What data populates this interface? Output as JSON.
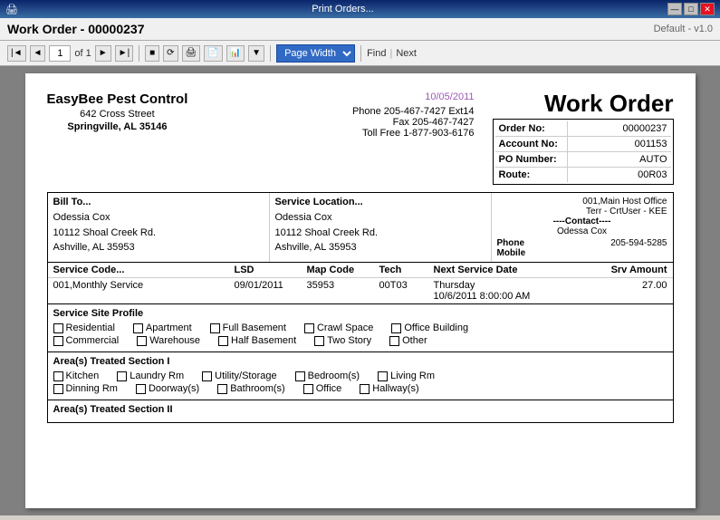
{
  "titleBar": {
    "title": "Print Orders...",
    "buttons": [
      "—",
      "□",
      "✕"
    ]
  },
  "workOrderHeader": {
    "title": "Work Order - 00000237",
    "default": "Default - v1.0"
  },
  "toolbar": {
    "prevFirst": "|◄",
    "prev": "◄",
    "pageNum": "1",
    "ofLabel": "of 1",
    "next": "►",
    "nextLast": "►|",
    "refresh": "⟳",
    "pageWidth": "Page Width",
    "find": "Find",
    "next2": "Next"
  },
  "document": {
    "date": "10/05/2011",
    "mainTitle": "Work Order",
    "company": {
      "name": "EasyBee Pest Control",
      "address": "642 Cross Street",
      "cityState": "Springville, AL 35146"
    },
    "phone": {
      "phone": "Phone 205-467-7427 Ext14",
      "fax": "Fax 205-467-7427",
      "tollFree": "Toll Free 1-877-903-6176"
    },
    "orderInfo": [
      {
        "label": "Order No:",
        "value": "00000237"
      },
      {
        "label": "Account No:",
        "value": "001153"
      },
      {
        "label": "PO Number:",
        "value": "AUTO"
      },
      {
        "label": "Route:",
        "value": "00R03"
      }
    ],
    "billTo": {
      "header": "Bill To...",
      "line1": "Odessia Cox",
      "line2": "10112 Shoal Creek Rd.",
      "line3": "Ashville, AL 35953"
    },
    "serviceLoc": {
      "header": "Service Location...",
      "line1": "Odessia Cox",
      "line2": "10112 Shoal Creek Rd.",
      "line3": "Ashville, AL 35953"
    },
    "contactInfo": {
      "territory": "001,Main Host Office",
      "terr2": "Terr - CrtUser - KEE",
      "contactLabel": "----Contact----",
      "name": "Odessa Cox",
      "phoneLabel": "Phone",
      "phone": "205-594-5285",
      "mobileLabel": "Mobile"
    },
    "serviceTable": {
      "headers": [
        "Service Code...",
        "LSD",
        "Map Code",
        "Tech",
        "Next Service Date",
        "Srv Amount"
      ],
      "row": {
        "code": "001,Monthly Service",
        "lsd": "09/01/2011",
        "mapCode": "35953",
        "tech": "00T03",
        "nextService": "Thursday\n10/6/2011 8:00:00 AM",
        "amount": "27.00"
      }
    },
    "serviceSiteProfile": {
      "header": "Service Site Profile",
      "checkboxes1": [
        "Residential",
        "Apartment",
        "Full Basement",
        "Crawl Space",
        "Office Building"
      ],
      "checkboxes2": [
        "Commercial",
        "Warehouse",
        "Half Basement",
        "Two Story",
        "Other"
      ]
    },
    "areasTreated1": {
      "header": "Area(s) Treated Section I",
      "row1": [
        "Kitchen",
        "Laundry Rm",
        "Utility/Storage",
        "Bedroom(s)",
        "Living Rm"
      ],
      "row2": [
        "Dinning Rm",
        "Doorway(s)",
        "Bathroom(s)",
        "Office",
        "Hallway(s)"
      ]
    },
    "areasTreated2": {
      "header": "Area(s) Treated Section II"
    }
  }
}
